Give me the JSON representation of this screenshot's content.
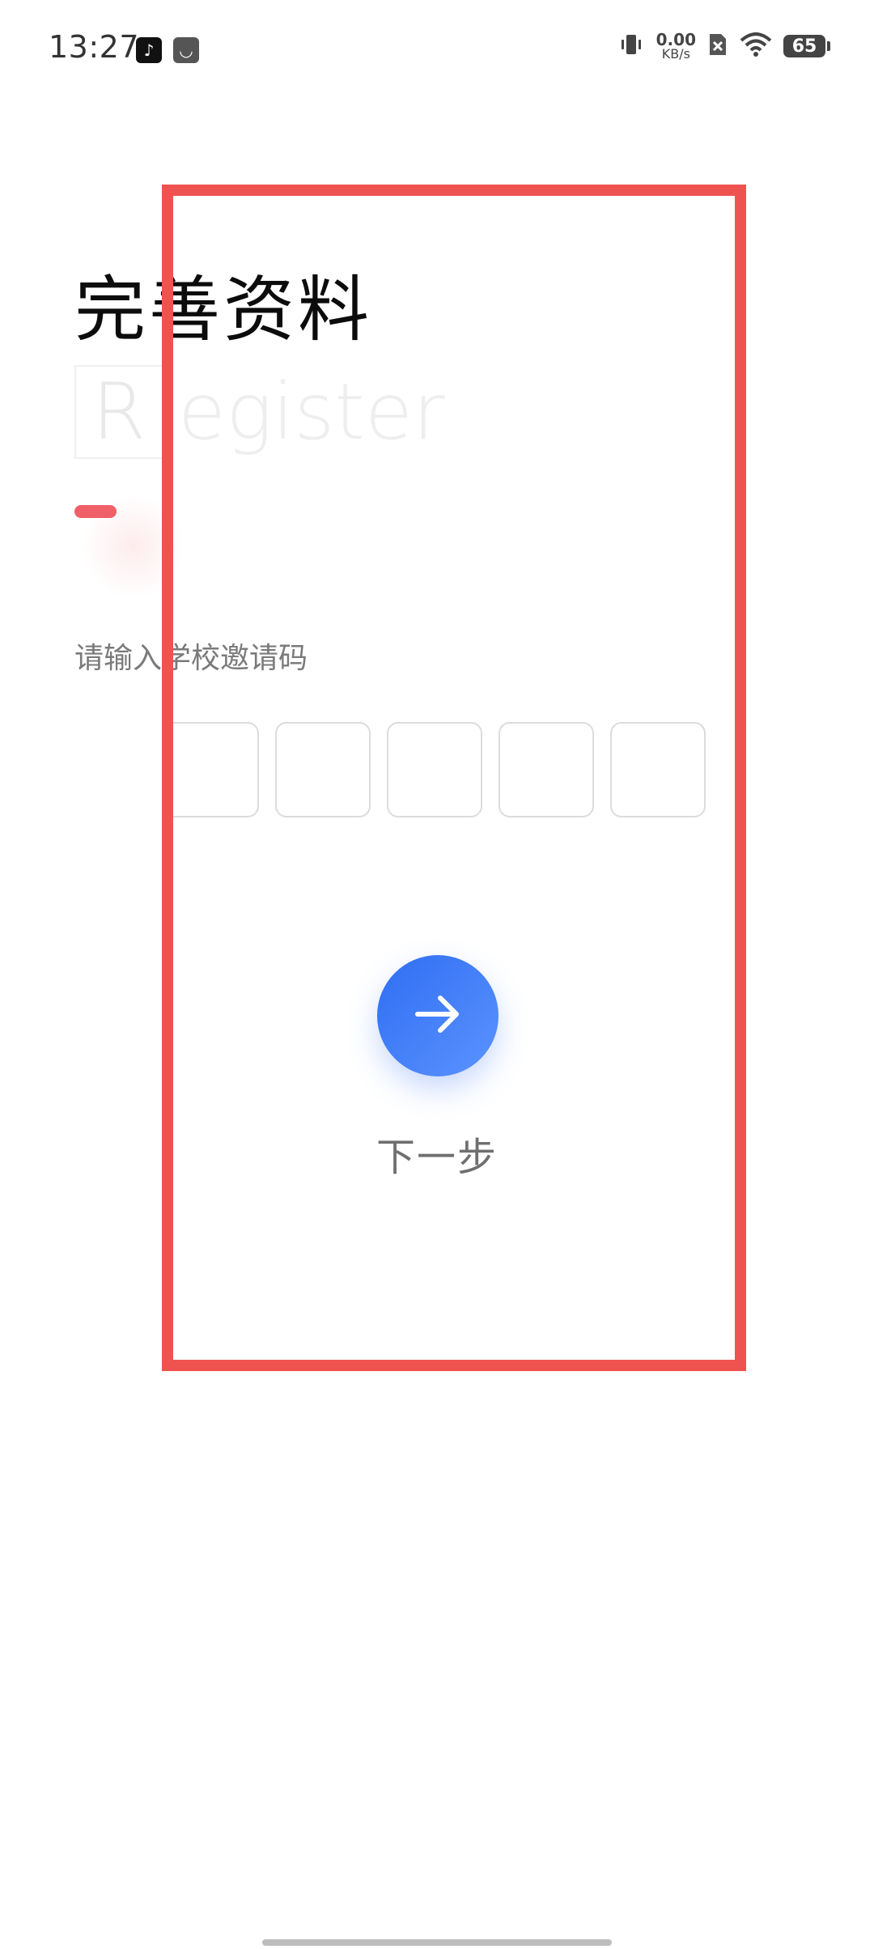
{
  "status_bar": {
    "time": "13:27",
    "net_speed_value": "0.00",
    "net_speed_unit": "KB/s",
    "battery": "65",
    "icons": [
      "tiktok-icon",
      "bag-icon",
      "vibrate-icon",
      "no-sim-icon",
      "wifi-icon",
      "battery-icon"
    ]
  },
  "page": {
    "title": "完善资料",
    "watermark_first": "R",
    "watermark_rest": "egister",
    "invite_label": "请输入学校邀请码",
    "code_box_count": 5,
    "next_label": "下一步"
  },
  "colors": {
    "accent": "#f06068",
    "primary_blue": "#2f6ef2",
    "highlight": "#ef5350"
  }
}
